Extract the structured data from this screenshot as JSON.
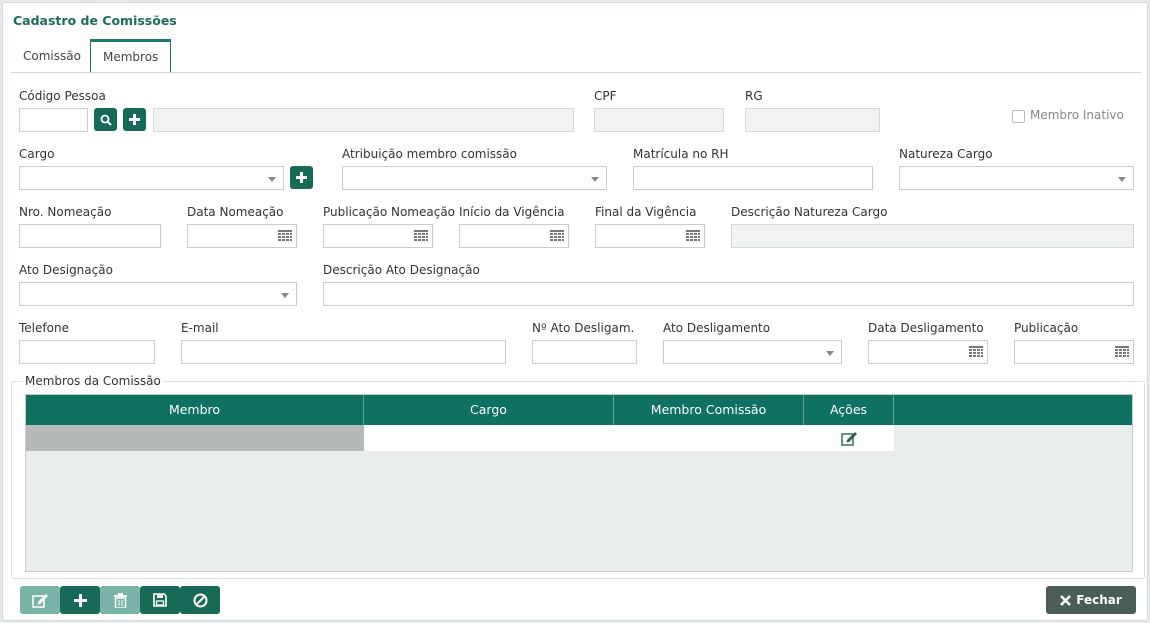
{
  "window": {
    "title": "Cadastro de Comissões"
  },
  "tabs": [
    {
      "label": "Comissão",
      "active": false
    },
    {
      "label": "Membros",
      "active": true
    }
  ],
  "form": {
    "codigo_pessoa": {
      "label": "Código Pessoa",
      "value": "",
      "name_value": ""
    },
    "cpf": {
      "label": "CPF",
      "value": ""
    },
    "rg": {
      "label": "RG",
      "value": ""
    },
    "membro_inativo": {
      "label": "Membro Inativo",
      "checked": false
    },
    "cargo": {
      "label": "Cargo",
      "value": ""
    },
    "atribuicao": {
      "label": "Atribuição membro comissão",
      "value": ""
    },
    "matricula": {
      "label": "Matrícula no RH",
      "value": ""
    },
    "natureza_cargo": {
      "label": "Natureza Cargo",
      "value": ""
    },
    "nro_nomeacao": {
      "label": "Nro. Nomeação",
      "value": ""
    },
    "data_nomeacao": {
      "label": "Data Nomeação",
      "value": ""
    },
    "publicacao_nomeacao": {
      "label": "Publicação Nomeação",
      "value": ""
    },
    "inicio_vigencia": {
      "label": "Início da Vigência",
      "value": ""
    },
    "final_vigencia": {
      "label": "Final da Vigência",
      "value": ""
    },
    "descricao_natureza": {
      "label": "Descrição Natureza Cargo",
      "value": ""
    },
    "ato_designacao": {
      "label": "Ato Designação",
      "value": ""
    },
    "descricao_ato": {
      "label": "Descrição Ato Designação",
      "value": ""
    },
    "telefone": {
      "label": "Telefone",
      "value": ""
    },
    "email": {
      "label": "E-mail",
      "value": ""
    },
    "nro_ato_deslig": {
      "label": "Nº Ato Desligam.",
      "value": ""
    },
    "ato_desligamento": {
      "label": "Ato Desligamento",
      "value": ""
    },
    "data_desligamento": {
      "label": "Data Desligamento",
      "value": ""
    },
    "publicacao": {
      "label": "Publicação",
      "value": ""
    }
  },
  "members_grid": {
    "legend": "Membros da Comissão",
    "columns": [
      "Membro",
      "Cargo",
      "Membro Comissão",
      "Ações"
    ],
    "rows": [
      {
        "membro": "",
        "cargo": "",
        "membro_comissao": "",
        "acoes_icon": "edit-icon"
      }
    ]
  },
  "toolbar": {
    "buttons": [
      {
        "icon": "edit-icon",
        "enabled": false
      },
      {
        "icon": "plus-icon",
        "enabled": true
      },
      {
        "icon": "trash-icon",
        "enabled": false
      },
      {
        "icon": "save-icon",
        "enabled": true
      },
      {
        "icon": "cancel-icon",
        "enabled": true
      }
    ],
    "close_label": "Fechar"
  },
  "colors": {
    "primary": "#176b56",
    "header": "#0f7160",
    "title": "#1e6b5c",
    "close": "#4a5d58"
  }
}
